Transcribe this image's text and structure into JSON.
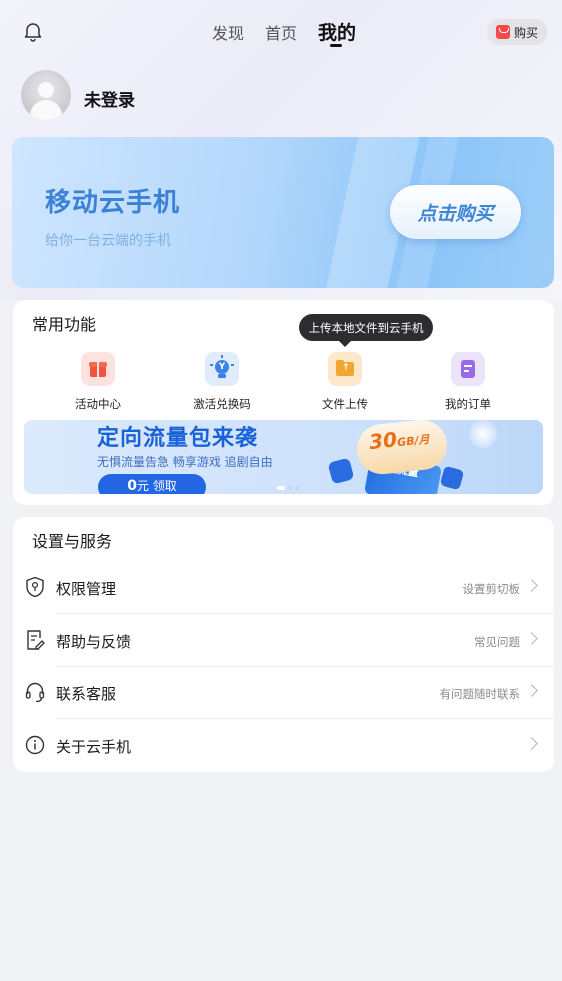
{
  "topbar": {
    "tabs": [
      {
        "label": "发现"
      },
      {
        "label": "首页"
      },
      {
        "label": "我的"
      }
    ],
    "buy_label": "购买"
  },
  "profile": {
    "name": "未登录"
  },
  "banner": {
    "title": "移动云手机",
    "subtitle": "给你一台云端的手机",
    "button": "点击购买"
  },
  "functions": {
    "title": "常用功能",
    "tooltip": "上传本地文件到云手机",
    "items": [
      {
        "label": "活动中心",
        "icon": "gift-icon"
      },
      {
        "label": "激活兑换码",
        "icon": "lightbulb-icon"
      },
      {
        "label": "文件上传",
        "icon": "folder-upload-icon"
      },
      {
        "label": "我的订单",
        "icon": "order-icon"
      }
    ],
    "promo": {
      "title": "定向流量包来袭",
      "subtitle": "无惧流量告急 畅享游戏 追剧自由",
      "button_num": "0",
      "button_text": "元 领取",
      "badge_num": "30",
      "badge_unit": "GB/月",
      "card_text": "云机流量"
    }
  },
  "settings": {
    "title": "设置与服务",
    "rows": [
      {
        "label": "权限管理",
        "hint": "设置剪切板",
        "icon": "shield-icon"
      },
      {
        "label": "帮助与反馈",
        "hint": "常见问题",
        "icon": "feedback-icon"
      },
      {
        "label": "联系客服",
        "hint": "有问题随时联系",
        "icon": "headset-icon"
      },
      {
        "label": "关于云手机",
        "hint": "",
        "icon": "info-icon"
      }
    ]
  }
}
